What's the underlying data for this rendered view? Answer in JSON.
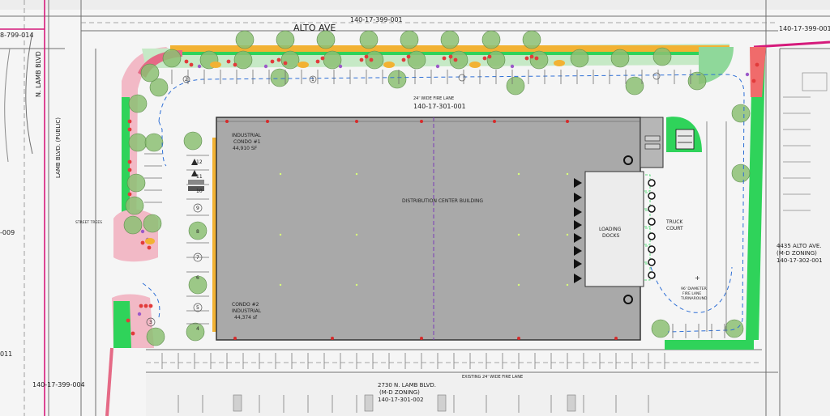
{
  "labels": {
    "street_top": "ALTO AVE",
    "street_left": "N. LAMB BLVD",
    "lamb_public": "LAMB BLVD. (PUBLIC)",
    "parcel_top_center": "140-17-399-001",
    "parcel_top_right": "140-17-399-001",
    "parcel_top_left": "8-799-014",
    "parcel_left_mid": "-009",
    "parcel_left_low": "011",
    "parcel_main": "140-17-301-001",
    "parcel_bottom_left": "140-17-399-004",
    "building": "DISTRIBUTION CENTER BUILDING",
    "condo1_line1": "INDUSTRIAL",
    "condo1_line2": "CONDO #1",
    "condo1_area": "44,910 SF",
    "condo2_line1": "CONDO #2",
    "condo2_line2": "INDUSTRIAL",
    "condo2_area": "44,374 sf",
    "loading_line1": "LOADING",
    "loading_line2": "DOCKS",
    "truck_line1": "TRUCK",
    "truck_line2": "COURT",
    "turnaround_line1": "96' DIAMETER",
    "turnaround_line2": "FIRE LANE",
    "turnaround_line3": "TURNAROUND",
    "fire_lane_top": "24' WIDE FIRE LANE",
    "fire_lane_bottom": "EXISTING 24' WIDE FIRE LANE",
    "south_addr": "2730 N. LAMB BLVD.",
    "south_zoning": "(M-D ZONING)",
    "south_parcel": "140-17-301-002",
    "east_addr": "4435 ALTO AVE.",
    "east_zoning": "(M-D ZONING)",
    "east_parcel": "140-17-302-001",
    "street_trees_note": "STREET TREES"
  },
  "stall_numbers": [
    "12",
    "11",
    "10",
    "9",
    "8",
    "7",
    "6",
    "5",
    "4",
    "3",
    "2",
    "1"
  ],
  "colors": {
    "building_fill": "#a9a9a9",
    "landscape_green": "#2fd35a",
    "decomposed_granite": "#f2b233",
    "tree_fill": "#8cbf73",
    "flower_red": "#e23b3b",
    "pink_border": "#e56a86",
    "parcel_line": "#d51a7b",
    "fire_lane_blue": "#2e6fd6",
    "purple_line": "#7a3db8"
  }
}
